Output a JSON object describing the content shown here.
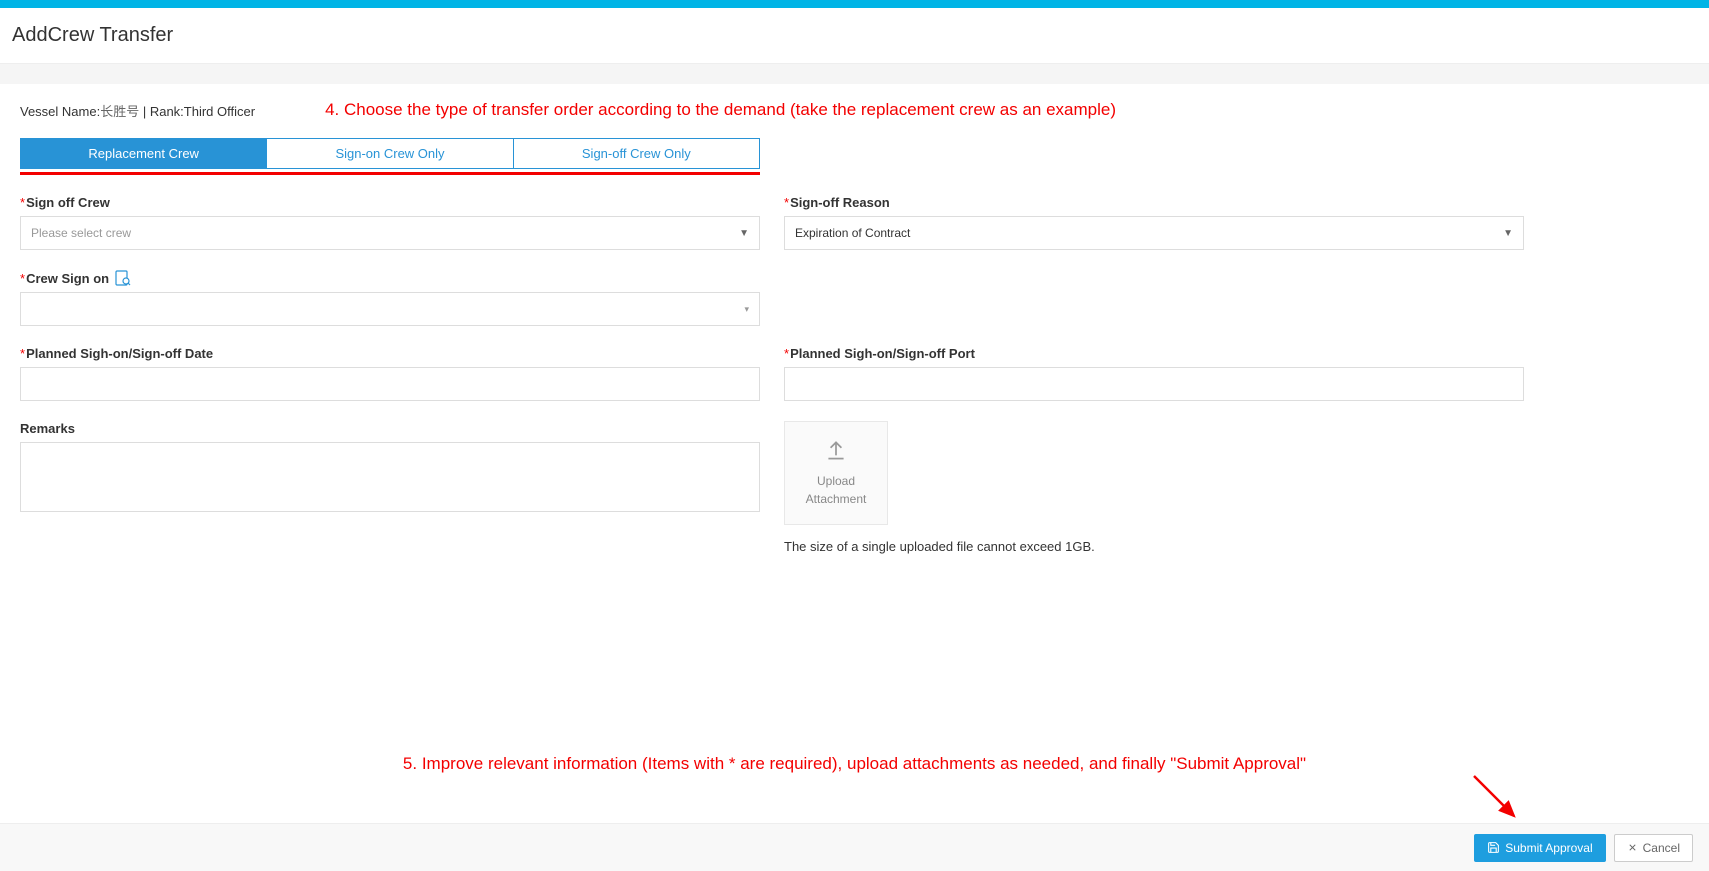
{
  "header": {
    "title": "AddCrew Transfer"
  },
  "info": {
    "vessel_label": "Vessel Name:",
    "vessel_value": "长胜号",
    "separator": " | ",
    "rank_label": "Rank:",
    "rank_value": "Third Officer"
  },
  "annotations": {
    "step4": "4. Choose the type of transfer order according to the demand (take the replacement crew as an example)",
    "step5": "5. Improve relevant information (Items with * are required), upload attachments as needed, and finally \"Submit Approval\""
  },
  "tabs": {
    "replacement": "Replacement Crew",
    "signon_only": "Sign-on Crew Only",
    "signoff_only": "Sign-off Crew Only"
  },
  "fields": {
    "signoff_crew": {
      "label": "Sign off Crew",
      "placeholder": "Please select crew"
    },
    "signoff_reason": {
      "label": "Sign-off Reason",
      "value": "Expiration of Contract"
    },
    "crew_signon": {
      "label": "Crew Sign on"
    },
    "planned_date": {
      "label": "Planned Sigh-on/Sign-off Date"
    },
    "planned_port": {
      "label": "Planned Sigh-on/Sign-off Port"
    },
    "remarks": {
      "label": "Remarks"
    }
  },
  "upload": {
    "label_line1": "Upload",
    "label_line2": "Attachment",
    "hint": "The size of a single uploaded file cannot exceed 1GB."
  },
  "footer": {
    "submit": "Submit Approval",
    "cancel": "Cancel"
  }
}
